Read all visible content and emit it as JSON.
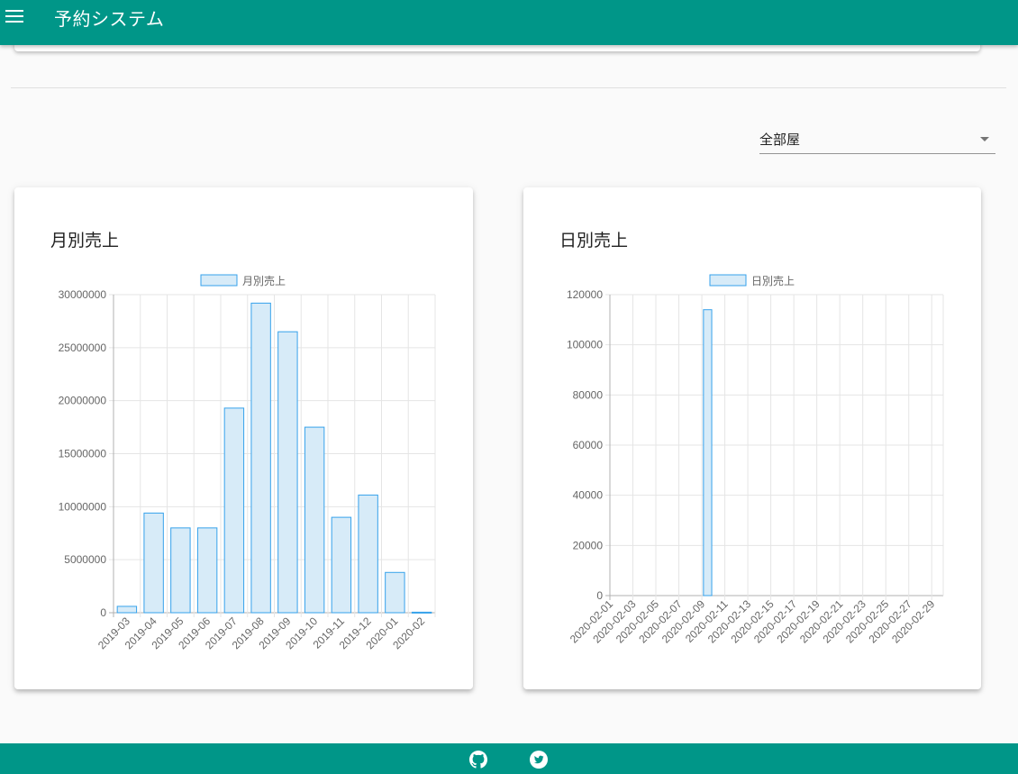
{
  "app_bar": {
    "title": "予約システム",
    "menu_icon": "hamburger-menu-icon",
    "color": "#009688"
  },
  "room_select": {
    "value": "全部屋",
    "icon": "dropdown-caret-icon"
  },
  "monthly_card": {
    "title": "月別売上",
    "chart_data": {
      "type": "bar",
      "title": "",
      "legend": {
        "label": "月別売上",
        "position": "top"
      },
      "categories": [
        "2019-03",
        "2019-04",
        "2019-05",
        "2019-06",
        "2019-07",
        "2019-08",
        "2019-09",
        "2019-10",
        "2019-11",
        "2019-12",
        "2020-01",
        "2020-02"
      ],
      "series": [
        {
          "name": "月別売上",
          "values": [
            600000,
            9400000,
            8000000,
            8000000,
            19300000,
            29200000,
            26500000,
            17500000,
            9000000,
            11100000,
            3800000,
            50000
          ]
        }
      ],
      "ylim": [
        0,
        30000000
      ],
      "yticks": [
        "0",
        "5000000",
        "10000000",
        "15000000",
        "20000000",
        "25000000",
        "30000000"
      ],
      "grid": true,
      "bar_fill": "#d7ebf8",
      "bar_stroke": "#36a2eb"
    }
  },
  "daily_card": {
    "title": "日別売上",
    "chart_data": {
      "type": "bar",
      "title": "",
      "legend": {
        "label": "日別売上",
        "position": "top"
      },
      "x": [
        "2020-02-01",
        "2020-02-02",
        "2020-02-03",
        "2020-02-04",
        "2020-02-05",
        "2020-02-06",
        "2020-02-07",
        "2020-02-08",
        "2020-02-09",
        "2020-02-10",
        "2020-02-11",
        "2020-02-12",
        "2020-02-13",
        "2020-02-14",
        "2020-02-15",
        "2020-02-16",
        "2020-02-17",
        "2020-02-18",
        "2020-02-19",
        "2020-02-20",
        "2020-02-21",
        "2020-02-22",
        "2020-02-23",
        "2020-02-24",
        "2020-02-25",
        "2020-02-26",
        "2020-02-27",
        "2020-02-28",
        "2020-02-29"
      ],
      "xticks": [
        "2020-02-01",
        "2020-02-03",
        "2020-02-05",
        "2020-02-07",
        "2020-02-09",
        "2020-02-11",
        "2020-02-13",
        "2020-02-15",
        "2020-02-17",
        "2020-02-19",
        "2020-02-21",
        "2020-02-23",
        "2020-02-25",
        "2020-02-27",
        "2020-02-29"
      ],
      "series": [
        {
          "name": "日別売上",
          "values": [
            0,
            0,
            0,
            0,
            0,
            0,
            0,
            0,
            114000,
            0,
            0,
            0,
            0,
            0,
            0,
            0,
            0,
            0,
            0,
            0,
            0,
            0,
            0,
            0,
            0,
            0,
            0,
            0,
            0
          ]
        }
      ],
      "ylim": [
        0,
        120000
      ],
      "yticks": [
        "0",
        "20000",
        "40000",
        "60000",
        "80000",
        "100000",
        "120000"
      ],
      "grid": true,
      "bar_fill": "#d7ebf8",
      "bar_stroke": "#36a2eb"
    }
  },
  "footer": {
    "icons": [
      "github-icon",
      "twitter-icon"
    ],
    "color": "#009688"
  }
}
